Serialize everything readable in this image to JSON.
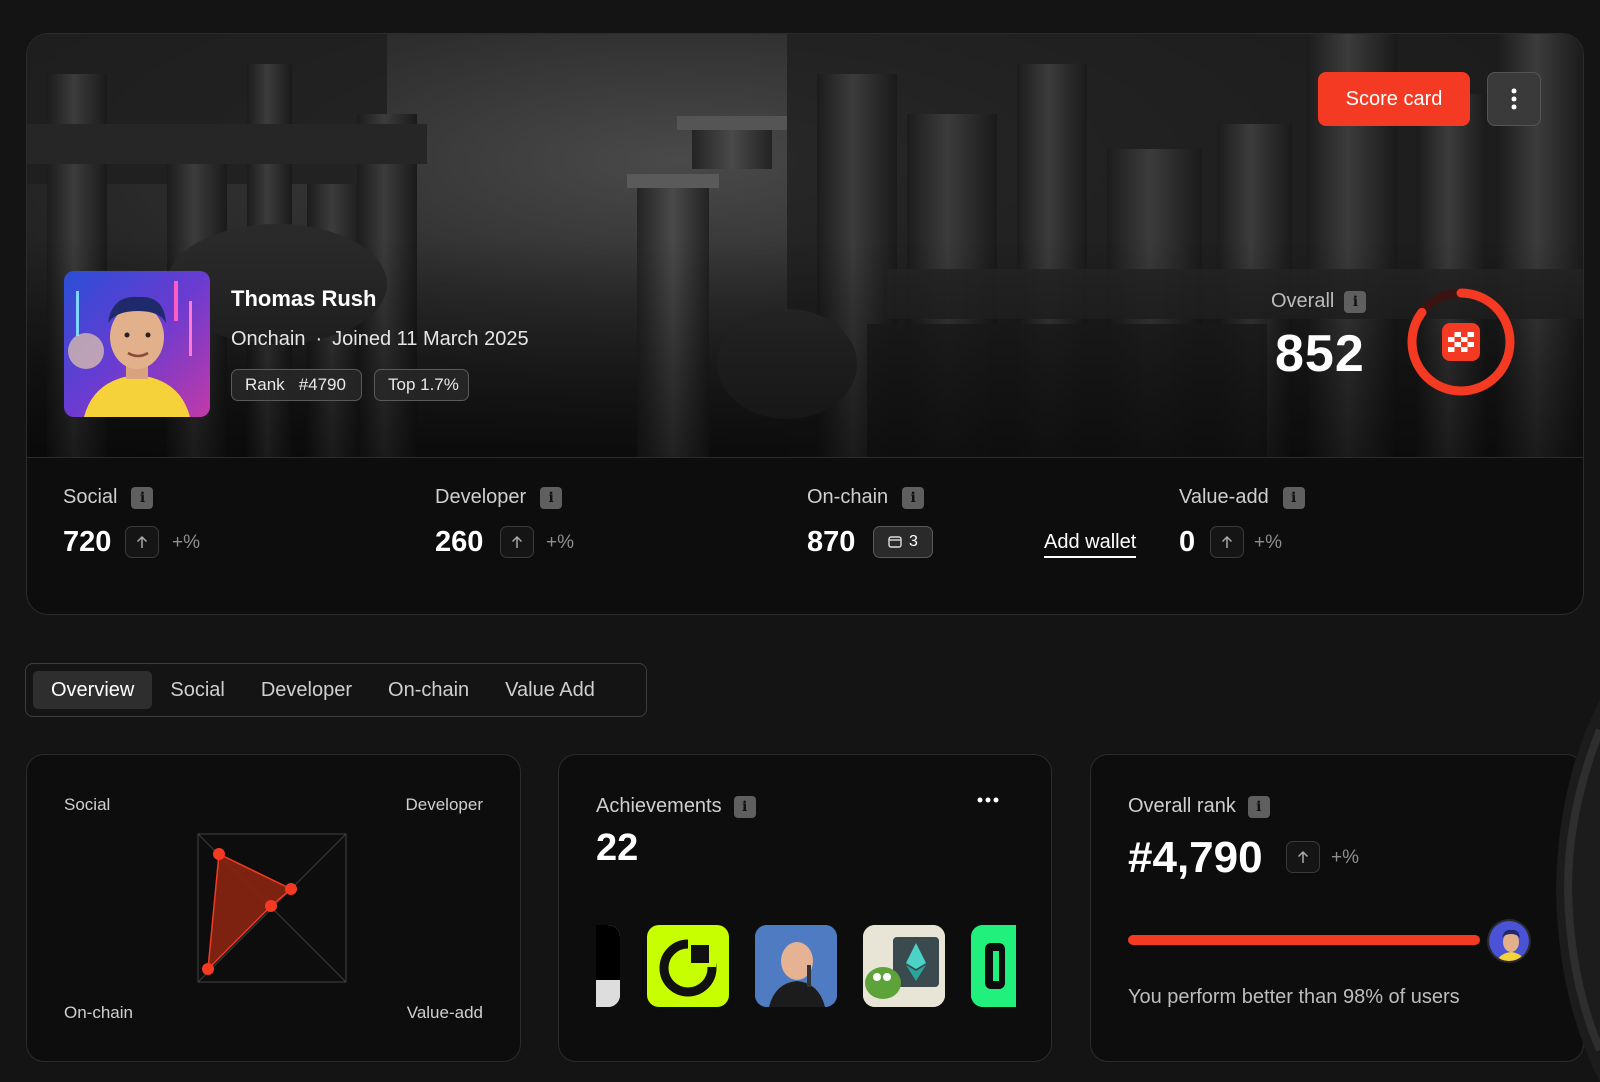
{
  "header": {
    "score_card_label": "Score card",
    "more_icon": "vertical-dots-icon"
  },
  "profile": {
    "name": "Thomas Rush",
    "category": "Onchain",
    "separator": "·",
    "joined": "Joined 11 March 2025",
    "rank_label": "Rank",
    "rank_value": "#4790",
    "top_percent": "Top 1.7%"
  },
  "overall": {
    "label": "Overall",
    "info": "i",
    "value": "852",
    "ring_fraction": 0.852,
    "accent_color": "#f43a22"
  },
  "stats": [
    {
      "label": "Social",
      "value": "720",
      "pct": "+%"
    },
    {
      "label": "Developer",
      "value": "260",
      "pct": "+%"
    },
    {
      "label": "On-chain",
      "value": "870",
      "wallet_count": "3",
      "add_wallet": "Add wallet"
    },
    {
      "label": "Value-add",
      "value": "0",
      "pct": "+%"
    }
  ],
  "tabs": [
    {
      "label": "Overview",
      "active": true
    },
    {
      "label": "Social"
    },
    {
      "label": "Developer"
    },
    {
      "label": "On-chain"
    },
    {
      "label": "Value Add"
    }
  ],
  "radar": {
    "labels": {
      "top_left": "Social",
      "top_right": "Developer",
      "bottom_left": "On-chain",
      "bottom_right": "Value-add"
    }
  },
  "achievements": {
    "title": "Achievements",
    "count": "22",
    "more_icon": "horizontal-dots-icon"
  },
  "overall_rank": {
    "title": "Overall rank",
    "value": "#4,790",
    "pct": "+%",
    "better_than_fraction": 0.98,
    "text": "You perform better than 98% of users"
  }
}
